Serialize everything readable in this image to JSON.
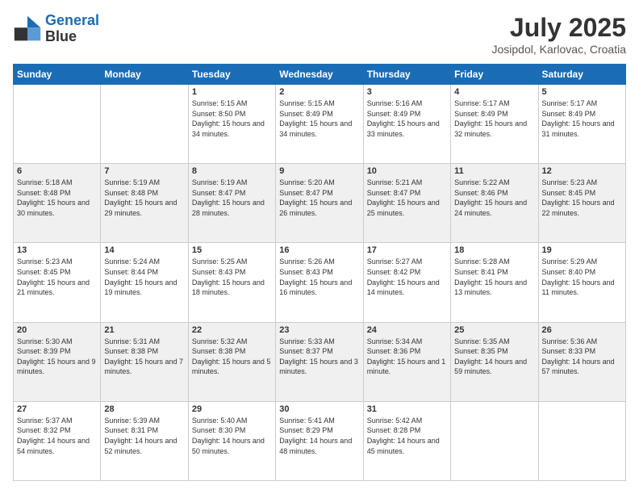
{
  "header": {
    "logo_line1": "General",
    "logo_line2": "Blue",
    "month_title": "July 2025",
    "location": "Josipdol, Karlovac, Croatia"
  },
  "weekdays": [
    "Sunday",
    "Monday",
    "Tuesday",
    "Wednesday",
    "Thursday",
    "Friday",
    "Saturday"
  ],
  "weeks": [
    [
      null,
      null,
      {
        "day": 1,
        "sunrise": "5:15 AM",
        "sunset": "8:50 PM",
        "daylight": "15 hours and 34 minutes."
      },
      {
        "day": 2,
        "sunrise": "5:15 AM",
        "sunset": "8:49 PM",
        "daylight": "15 hours and 34 minutes."
      },
      {
        "day": 3,
        "sunrise": "5:16 AM",
        "sunset": "8:49 PM",
        "daylight": "15 hours and 33 minutes."
      },
      {
        "day": 4,
        "sunrise": "5:17 AM",
        "sunset": "8:49 PM",
        "daylight": "15 hours and 32 minutes."
      },
      {
        "day": 5,
        "sunrise": "5:17 AM",
        "sunset": "8:49 PM",
        "daylight": "15 hours and 31 minutes."
      }
    ],
    [
      {
        "day": 6,
        "sunrise": "5:18 AM",
        "sunset": "8:48 PM",
        "daylight": "15 hours and 30 minutes."
      },
      {
        "day": 7,
        "sunrise": "5:19 AM",
        "sunset": "8:48 PM",
        "daylight": "15 hours and 29 minutes."
      },
      {
        "day": 8,
        "sunrise": "5:19 AM",
        "sunset": "8:47 PM",
        "daylight": "15 hours and 28 minutes."
      },
      {
        "day": 9,
        "sunrise": "5:20 AM",
        "sunset": "8:47 PM",
        "daylight": "15 hours and 26 minutes."
      },
      {
        "day": 10,
        "sunrise": "5:21 AM",
        "sunset": "8:47 PM",
        "daylight": "15 hours and 25 minutes."
      },
      {
        "day": 11,
        "sunrise": "5:22 AM",
        "sunset": "8:46 PM",
        "daylight": "15 hours and 24 minutes."
      },
      {
        "day": 12,
        "sunrise": "5:23 AM",
        "sunset": "8:45 PM",
        "daylight": "15 hours and 22 minutes."
      }
    ],
    [
      {
        "day": 13,
        "sunrise": "5:23 AM",
        "sunset": "8:45 PM",
        "daylight": "15 hours and 21 minutes."
      },
      {
        "day": 14,
        "sunrise": "5:24 AM",
        "sunset": "8:44 PM",
        "daylight": "15 hours and 19 minutes."
      },
      {
        "day": 15,
        "sunrise": "5:25 AM",
        "sunset": "8:43 PM",
        "daylight": "15 hours and 18 minutes."
      },
      {
        "day": 16,
        "sunrise": "5:26 AM",
        "sunset": "8:43 PM",
        "daylight": "15 hours and 16 minutes."
      },
      {
        "day": 17,
        "sunrise": "5:27 AM",
        "sunset": "8:42 PM",
        "daylight": "15 hours and 14 minutes."
      },
      {
        "day": 18,
        "sunrise": "5:28 AM",
        "sunset": "8:41 PM",
        "daylight": "15 hours and 13 minutes."
      },
      {
        "day": 19,
        "sunrise": "5:29 AM",
        "sunset": "8:40 PM",
        "daylight": "15 hours and 11 minutes."
      }
    ],
    [
      {
        "day": 20,
        "sunrise": "5:30 AM",
        "sunset": "8:39 PM",
        "daylight": "15 hours and 9 minutes."
      },
      {
        "day": 21,
        "sunrise": "5:31 AM",
        "sunset": "8:38 PM",
        "daylight": "15 hours and 7 minutes."
      },
      {
        "day": 22,
        "sunrise": "5:32 AM",
        "sunset": "8:38 PM",
        "daylight": "15 hours and 5 minutes."
      },
      {
        "day": 23,
        "sunrise": "5:33 AM",
        "sunset": "8:37 PM",
        "daylight": "15 hours and 3 minutes."
      },
      {
        "day": 24,
        "sunrise": "5:34 AM",
        "sunset": "8:36 PM",
        "daylight": "15 hours and 1 minute."
      },
      {
        "day": 25,
        "sunrise": "5:35 AM",
        "sunset": "8:35 PM",
        "daylight": "14 hours and 59 minutes."
      },
      {
        "day": 26,
        "sunrise": "5:36 AM",
        "sunset": "8:33 PM",
        "daylight": "14 hours and 57 minutes."
      }
    ],
    [
      {
        "day": 27,
        "sunrise": "5:37 AM",
        "sunset": "8:32 PM",
        "daylight": "14 hours and 54 minutes."
      },
      {
        "day": 28,
        "sunrise": "5:39 AM",
        "sunset": "8:31 PM",
        "daylight": "14 hours and 52 minutes."
      },
      {
        "day": 29,
        "sunrise": "5:40 AM",
        "sunset": "8:30 PM",
        "daylight": "14 hours and 50 minutes."
      },
      {
        "day": 30,
        "sunrise": "5:41 AM",
        "sunset": "8:29 PM",
        "daylight": "14 hours and 48 minutes."
      },
      {
        "day": 31,
        "sunrise": "5:42 AM",
        "sunset": "8:28 PM",
        "daylight": "14 hours and 45 minutes."
      },
      null,
      null
    ]
  ]
}
